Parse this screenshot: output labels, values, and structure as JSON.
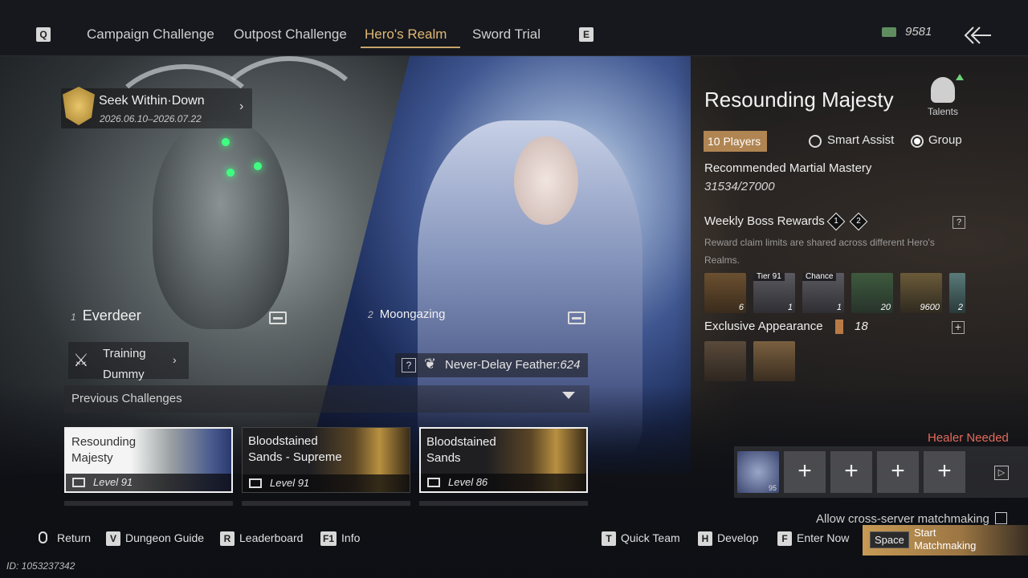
{
  "top_bar": {
    "prev_key": "Q",
    "next_key": "E",
    "tabs": [
      {
        "label": "Campaign Challenge"
      },
      {
        "label": "Outpost Challenge"
      },
      {
        "label": "Hero's Realm"
      },
      {
        "label": "Sword Trial"
      }
    ],
    "active_tab": "Hero's Realm",
    "currency": "9581",
    "currency_icon": "banknote-icon",
    "back_icon": "back-arrow-icon"
  },
  "event": {
    "title": "Seek Within·Down",
    "dates": "2026.06.10–2026.07.22"
  },
  "bosses": [
    {
      "number": "1",
      "name": "Everdeer"
    },
    {
      "number": "2",
      "name": "Moongazing"
    }
  ],
  "training": {
    "line1": "Training",
    "line2": "Dummy"
  },
  "feather": {
    "help": "?",
    "label": "Never-Delay Feather:",
    "value": "624"
  },
  "previous": {
    "label": "Previous Challenges"
  },
  "cards": [
    {
      "title": "Resounding Majesty",
      "level": "Level 91"
    },
    {
      "title": "Bloodstained Sands - Supreme",
      "level": "Level 91"
    },
    {
      "title": "Bloodstained Sands",
      "level": "Level 86"
    }
  ],
  "panel": {
    "title": "Resounding Majesty",
    "talents_label": "Talents",
    "players": "10 Players",
    "smart_assist": "Smart Assist",
    "group": "Group",
    "selected_mode": "Group",
    "rmm_label": "Recommended Martial Mastery",
    "rmm_value": "31534/27000",
    "weekly_label": "Weekly Boss Rewards",
    "weekly_badges": [
      "1",
      "2"
    ],
    "weekly_help": "?",
    "weekly_note": "Reward claim limits are shared across different Hero's Realms.",
    "rewards": [
      {
        "count": "6",
        "tag": ""
      },
      {
        "count": "1",
        "tag": "Tier 91"
      },
      {
        "count": "1",
        "tag": "Chance"
      },
      {
        "count": "20",
        "tag": ""
      },
      {
        "count": "9600",
        "tag": ""
      },
      {
        "count": "2",
        "tag": ""
      }
    ],
    "exclusive_label": "Exclusive Appearance",
    "exclusive_count": "18",
    "exclusive_plus": "+"
  },
  "team": {
    "healer": "Healer Needed",
    "avatar_level": "95",
    "empty_slot": "+",
    "expand": "▷",
    "cross_server": "Allow cross-server matchmaking"
  },
  "hints": [
    {
      "key": "",
      "label": "Return"
    },
    {
      "key": "V",
      "label": "Dungeon Guide"
    },
    {
      "key": "R",
      "label": "Leaderboard"
    },
    {
      "key": "F1",
      "label": "Info"
    },
    {
      "key": "T",
      "label": "Quick Team"
    },
    {
      "key": "H",
      "label": "Develop"
    },
    {
      "key": "F",
      "label": "Enter Now"
    }
  ],
  "start": {
    "key": "Space",
    "line1": "Start",
    "line2": "Matchmaking"
  },
  "uid": "ID: 1053237342"
}
